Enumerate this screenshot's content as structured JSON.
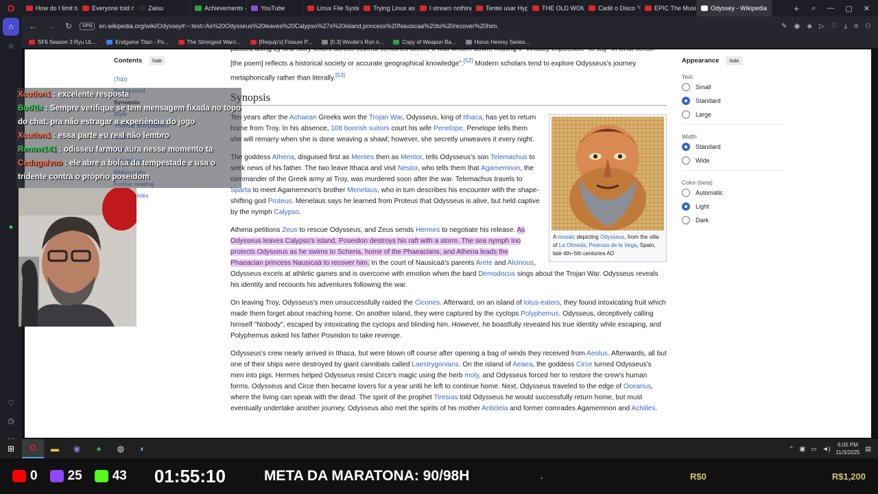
{
  "browser": {
    "tabs": [
      {
        "label": "How do I limit tw",
        "color": "#e0262b"
      },
      {
        "label": "Everyone told me",
        "color": "#e0262b"
      },
      {
        "label": "Zaisu",
        "color": "#2a2a2a"
      },
      {
        "label": "Achievements - K",
        "color": "#2ea043"
      },
      {
        "label": "YouTube",
        "color": "#8a50d8"
      },
      {
        "label": "Linux File System",
        "color": "#e0262b"
      },
      {
        "label": "Trying Linux as a",
        "color": "#e0262b"
      },
      {
        "label": "I stream nothing,",
        "color": "#e0262b"
      },
      {
        "label": "Tentei usar Hyprl",
        "color": "#e0262b"
      },
      {
        "label": "THE OLD WOMA",
        "color": "#e0262b"
      },
      {
        "label": "Cadê o Disco \"C\"",
        "color": "#e0262b"
      },
      {
        "label": "EPIC The Musical",
        "color": "#e0262b"
      },
      {
        "label": "Odyssey - Wikipedia",
        "color": "#ffffff"
      }
    ],
    "new_tab": "+",
    "url": "en.wikipedia.org/wiki/Odyssey#:~:text=As%20Odysseus%20leaves%20Calypso%27s%20island,princess%20Nausicaa%20to%20recover%20him.",
    "vpn_label": "VPN",
    "bookmarks": [
      {
        "label": "SF6 Season 3 Ryu UL...",
        "color": "#e0262b"
      },
      {
        "label": "Endgame Titan - Po...",
        "color": "#3b82f6"
      },
      {
        "label": "The Strongest Warri...",
        "color": "#e0262b"
      },
      {
        "label": "[Requip's] Fissure P...",
        "color": "#e0262b"
      },
      {
        "label": "[0.3] Woolie's Run n...",
        "color": "#888888"
      },
      {
        "label": "Copy of Weapon Ba...",
        "color": "#2ea043"
      },
      {
        "label": "Horus Heresy Series...",
        "color": "#888888"
      }
    ]
  },
  "wiki": {
    "contents_title": "Contents",
    "hide_label": "hide",
    "toc": [
      "(Top)",
      "Background",
      "Synopsis",
      "Style",
      "Themes and patterns",
      "Influence",
      "Analysis",
      "Adaptations",
      "Bibliography",
      "Further reading",
      "External links"
    ],
    "top_text_1": "passed along by oral story tellers across several centuries before it was written down, making it \"virtually impossible\" to say \"in what sense [the poem] reflects a historical society or accurate geographical knowledge\".",
    "cite_52": "[52]",
    "top_text_2": "Modern scholars tend to explore Odysseus's journey metaphorically rather than literally.",
    "cite_53": "[53]",
    "heading": "Synopsis",
    "p1": {
      "t1": "Ten years after the",
      "l1": "Achaean",
      "t2": "Greeks won the",
      "l2": "Trojan War",
      "t3": ", Odysseus, king of",
      "l3": "Ithaca",
      "t4": ", has yet to return home from Troy. In his absence,",
      "l4": "108 boorish suitors",
      "t5": "court his wife",
      "l5": "Penelope",
      "t6": ". Penelope tells them she will remarry when she is done weaving a shawl; however, she secretly unweaves it every night."
    },
    "p2": {
      "t1": "The goddess",
      "l1": "Athena",
      "t2": ", disguised first as",
      "l2": "Mentes",
      "t3": "then as",
      "l3": "Mentor",
      "t4": ", tells Odysseus's son",
      "l4": "Telemachus",
      "t5": "to seek news of his father. The two leave Ithaca and visit",
      "l5": "Nestor",
      "t6": ", who tells them that",
      "l6": "Agamemnon",
      "t7": ", the commander of the Greek army at Troy, was murdered soon after the war. Telemachus travels to",
      "l7": "Sparta",
      "t8": "to meet Agamemnon's brother",
      "l8": "Menelaus",
      "t9": ", who in turn describes his encounter with the shape-shifting god",
      "l9": "Proteus",
      "t10": ". Menelaus says he learned from Proteus that Odysseus is alive, but held captive by the nymph",
      "l10": "Calypso",
      "t11": "."
    },
    "p3": {
      "t1": "Athena petitions",
      "l1": "Zeus",
      "t2": "to rescue Odysseus, and Zeus sends",
      "l2": "Hermes",
      "t3": "to negotiate his release.",
      "hl": "As Odysseus leaves Calypso's island, Poseidon destroys his raft with a storm. The sea nymph Ino protects Odysseus as he swims to Scheria, home of the Phaeacians, and Athena leads the Phaeacian princess Nausicaä to recover him.",
      "t4": "In the court of Nausicaä's parents",
      "l3": "Arete",
      "t5": "and",
      "l4": "Alcinous",
      "t6": ", Odysseus excels at athletic games and is overcome with emotion when the bard",
      "l5": "Demodocus",
      "t7": "sings about the Trojan War. Odysseus reveals his identity and recounts his adventures following the war."
    },
    "p4": {
      "t1": "On leaving Troy, Odysseus's men unsuccessfully raided the",
      "l1": "Cicones",
      "t2": ". Afterward, on an island of",
      "l2": "lotus-eaters",
      "t3": ", they found intoxicating fruit which made them forget about reaching home. On another island, they were captured by the cyclops",
      "l3": "Polyphemus",
      "t4": ". Odysseus, deceptively calling himself \"Nobody\", escaped by intoxicating the cyclops and blinding him. However, he boastfully revealed his true identity while escaping, and Polyphemus asked his father Poseidon to take revenge."
    },
    "p5": {
      "t1": "Odysseus's crew nearly arrived in Ithaca, but were blown off course after opening a bag of winds they received from",
      "l1": "Aeolus",
      "t2": ". Afterwards, all but one of their ships were destroyed by giant cannibals called",
      "l2": "Laestrygonians",
      "t3": ". On the island of",
      "l3": "Aeaea",
      "t4": ", the goddess",
      "l4": "Circe",
      "t5": "turned Odysseus's men into pigs. Hermes helped Odysseus resist Circe's magic using the herb",
      "l5": "moly",
      "t6": ", and Odysseus forced her to restore the crew's human forms. Odysseus and Circe then became lovers for a year until he left to continue home. Next, Odysseus traveled to the edge of",
      "l6": "Oceanus",
      "t7": ", where the living can speak with the dead. The spirit of the prophet",
      "l7": "Tiresias",
      "t8": "told Odysseus he would successfully return home, but must eventually undertake another journey. Odysseus also met the spirits of his mother",
      "l8": "Anticleia",
      "t9": "and former comrades Agamemnon and",
      "l9": "Achilles",
      "t10": "."
    },
    "caption": {
      "t1": "A",
      "l1": "mosaic",
      "t2": "depicting",
      "l2": "Odysseus",
      "t3": ", from the villa of",
      "l3": "La Olmeda",
      "t4": ",",
      "l4": "Pedrosa de la Vega",
      "t5": ", Spain, late 4th–5th centuries AD"
    },
    "appearance": {
      "title": "Appearance",
      "text_label": "Text",
      "text_options": [
        "Small",
        "Standard",
        "Large"
      ],
      "text_selected": 1,
      "width_label": "Width",
      "width_options": [
        "Standard",
        "Wide"
      ],
      "width_selected": 0,
      "color_label": "Color (beta)",
      "color_options": [
        "Automatic",
        "Light",
        "Dark"
      ],
      "color_selected": 1
    }
  },
  "chat": [
    {
      "user": "Xcution1",
      "color": "#ff6a3d",
      "text": ": excelente resposta"
    },
    {
      "user": "BotRix",
      "color": "#34d058",
      "text": ": Sempre verifique se tem mensagem fixada no topo do chat, pra não estragar a experiência do jogo"
    },
    {
      "user": "Xcution1",
      "color": "#ff6a3d",
      "text": ": essa parte eu real não lembro"
    },
    {
      "user": "Renow141",
      "color": "#34d058",
      "text": ": odisseu farmou aura nesse momento ta"
    },
    {
      "user": "Cedugalvao",
      "color": "#ff6a3d",
      "text": ": ele abre a bolsa da tempestade e usa o tridente contra o próprio poseidom"
    }
  ],
  "taskbar": {
    "time": "6:05 PM",
    "date": "11/3/2025"
  },
  "stream": {
    "youtube_count": "0",
    "twitch_count": "25",
    "kick_count": "43",
    "timer": "01:55:10",
    "goal_text": "META DA MARATONA: 90/98H",
    "donation_current": "R$0",
    "donation_goal": "R$1,200",
    "dot": "."
  }
}
